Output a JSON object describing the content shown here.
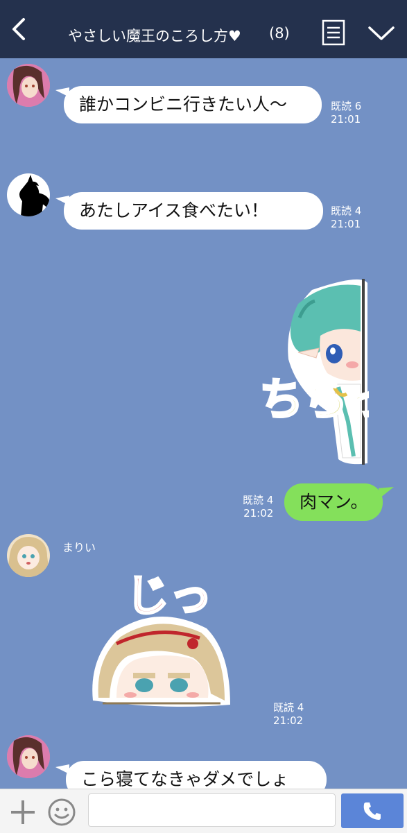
{
  "header": {
    "title": "やさしい魔王のころし方♥",
    "member_count": "(8)",
    "background": "#24314d"
  },
  "chat": {
    "background": "#7391c5",
    "messages": [
      {
        "type": "text",
        "side": "left",
        "text": "誰かコンビニ行きたい人～",
        "read": "既読 6",
        "time": "21:01"
      },
      {
        "type": "text",
        "side": "left",
        "text": "あたしアイス食べたい！",
        "read": "既読 4",
        "time": "21:01"
      },
      {
        "type": "sticker",
        "side": "right",
        "sticker_text": "ちらっ"
      },
      {
        "type": "text",
        "side": "right",
        "text": "肉マン。",
        "read": "既読 4",
        "time": "21:02",
        "bubble_color": "#84e05b"
      },
      {
        "type": "sticker",
        "side": "left",
        "sender": "まりい",
        "sticker_text": "じっ",
        "read": "既読 4",
        "time": "21:02"
      },
      {
        "type": "text",
        "side": "left",
        "text": "こら寝てなきゃダメでしょ"
      }
    ]
  },
  "footer": {
    "input_placeholder": "",
    "call_color": "#5b85d8"
  }
}
